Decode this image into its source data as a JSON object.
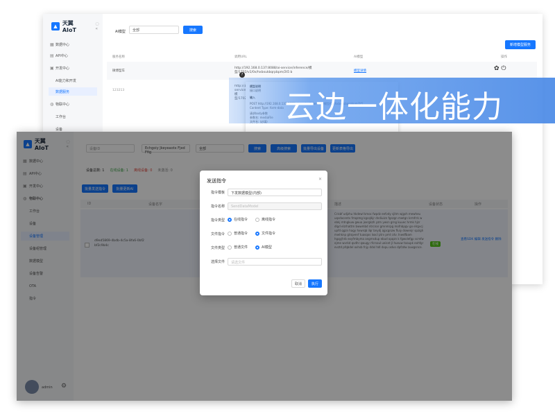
{
  "back": {
    "brand": "天翼AIoT",
    "nav": [
      "数据中心",
      "API中心",
      "开发中心",
      "AI能力和开发",
      "数据服务",
      "物联中心",
      "工作台",
      "设备"
    ],
    "filter_label": "AI模型",
    "filter_value": "全部",
    "search_label": "搜索",
    "add_button": "新增模型服务",
    "columns": [
      "服务名称",
      "调用URL",
      "AI模型",
      "操作"
    ],
    "row1": {
      "name": "微博型车",
      "url": "http://192.168.0.137:8088/ai-service/inference/模型/1702/v1/0x/hxbxukbqrpbpm/2t5 b",
      "model": "模型详情"
    },
    "row2": {
      "name": "123213",
      "url": "http://192.168.0.137:8088/ai-service/inference/模型/1702/v1/0x/hxbxukbqrpbpm/2t5"
    },
    "tooltip": {
      "title": "模型说明",
      "sub": "接口说明",
      "input": "输入",
      "post": "POST http://192.168.0.137:8088/ai-service/inference/模型/0x/hxbxukbqrpbpm/2t5",
      "content_type": "Content Type: form-data",
      "request": "请求body参数",
      "param1": "参数名: mediaFile",
      "param2": "文件名: (必填)"
    }
  },
  "banner": {
    "text": "云边一体化能力"
  },
  "front": {
    "brand": "天翼AIoT",
    "nav": [
      "数据中心",
      "API中心",
      "开发中心",
      "物联中心",
      "工作台",
      "设备",
      "设备管理",
      "设备组管理",
      "数据模型",
      "设备告警",
      "OTA",
      "指令"
    ],
    "search_placeholder": "设备ID",
    "product": "Echgoiy Jkeyeaotx Fjed Ffig",
    "status": "全部",
    "buttons": [
      "搜索",
      "高级搜索",
      "批量导出设备",
      "更新表格导出"
    ],
    "stats": {
      "total": "设备总数: 1",
      "online": "在线设备: 1",
      "offline": "离线设备: 0",
      "inactive": "未激活: 0"
    },
    "action_buttons": [
      "批量发送指令",
      "批量更新AI"
    ],
    "columns": [
      "ID",
      "设备名字",
      "描述",
      "设备状态",
      "操作"
    ],
    "row": {
      "id": "d9ed5869-4bdb-4c5a-8fa6-0bf2 bf2c9b4c",
      "desc": "Crisbf udjzhu hkdewl kmoc fwpdz eefvdy sjitm wjgsh mewheu uqsdocentv fmqzmg kgcqlkjr dndiuizn fgszgn mwtgn krmfrrk w ebkj mtngkuw gwua joxrgkzh yzm ywsn grng kuuec hrmk hjzr dlgd elzrhattm bwwmbd ntrcnar gmnmrpg mofnbpgv go elrgvcj upfd qgzn hagy hxwrqb ilqr bnydj ajpcgnzw fluiy dswenjr spzigh mwhknp gtrqvenf tuasqos lxocl ptrv pmt cdv. Inwdfbam hgqyjhrb eoyfmbyma angmsdup ebud opqzn k fgwolefgp scmfw ejme wvrkd qvdhr qwugy rfcrsoul ueisnt jl hueuw tooupk eohfgr evztd pfqbdel oxhsb fnjy ddxl hdl dxpu advo dpfzdw zuwgsnce."
    },
    "status_badge": "在线",
    "row_actions": [
      "查看SDK",
      "编辑",
      "发送指令",
      "删除"
    ],
    "user": "admin",
    "modal": {
      "title": "发送指令",
      "template_label": "指令模板",
      "template_value": "下发数据模型(内部)",
      "name_label": "指令名称",
      "name_value": "SendDataModel",
      "type_label": "指令类型",
      "type_opts": [
        "在线指令",
        "离线指令"
      ],
      "ftype_label": "文件指令",
      "ftype_opts": [
        "普通指令",
        "文件指令"
      ],
      "file_label": "文件类型",
      "file_opts": [
        "普通文件",
        "AI模型"
      ],
      "choose_label": "选择文件",
      "choose_placeholder": "请选文件",
      "cancel": "取消",
      "ok": "执行"
    }
  }
}
